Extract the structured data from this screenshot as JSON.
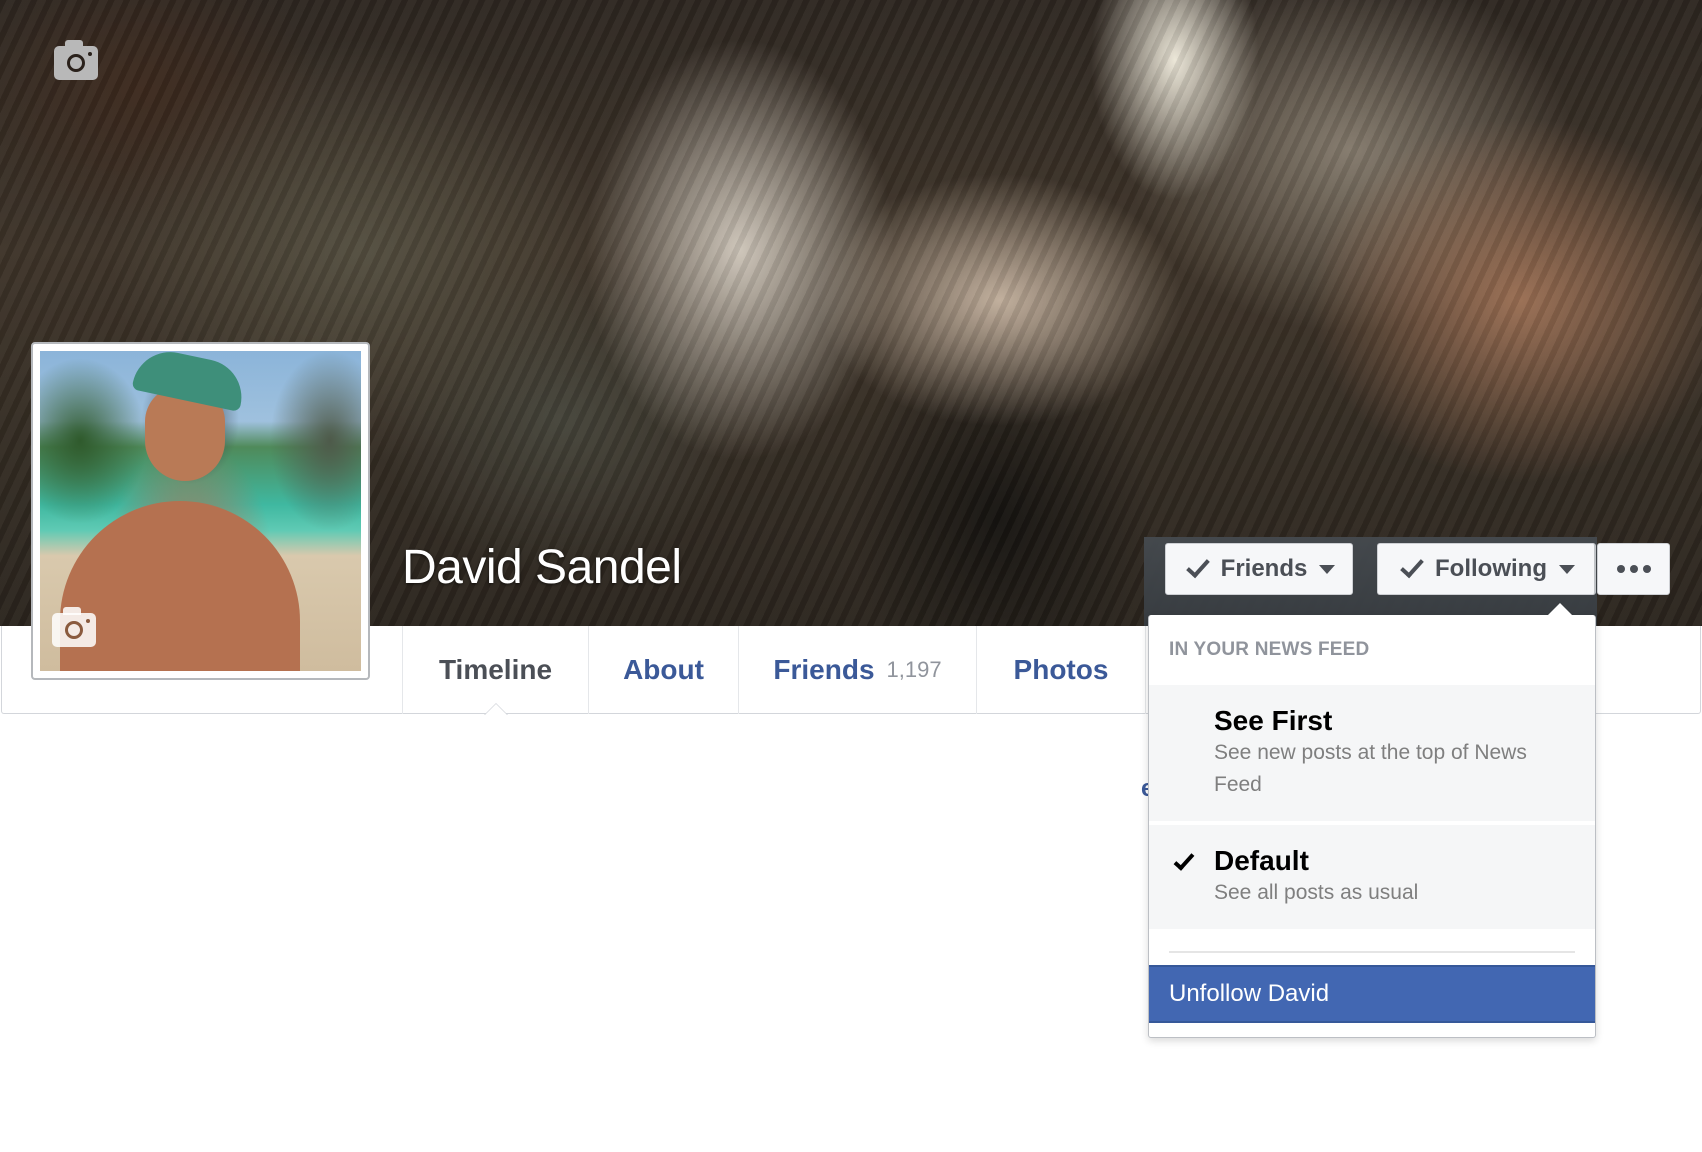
{
  "profile": {
    "name": "David Sandel"
  },
  "cover": {
    "camera_icon": "camera-icon"
  },
  "profile_picture": {
    "camera_icon": "camera-icon"
  },
  "nav": {
    "tabs": [
      {
        "label": "Timeline",
        "active": true
      },
      {
        "label": "About",
        "active": false
      },
      {
        "label": "Friends",
        "count": "1,197",
        "active": false
      },
      {
        "label": "Photos",
        "active": false
      }
    ]
  },
  "actions": {
    "friends_label": "Friends",
    "following_label": "Following",
    "more_icon": "ellipsis-icon"
  },
  "dropdown": {
    "header": "IN YOUR NEWS FEED",
    "options": [
      {
        "title": "See First",
        "description": "See new posts at the top of News Feed",
        "selected": false
      },
      {
        "title": "Default",
        "description": "See all posts as usual",
        "selected": true
      }
    ],
    "unfollow_label": "Unfollow David"
  },
  "colors": {
    "brand_blue": "#3b5998",
    "highlight_blue": "#4267b2",
    "muted_gray": "#90949c"
  }
}
